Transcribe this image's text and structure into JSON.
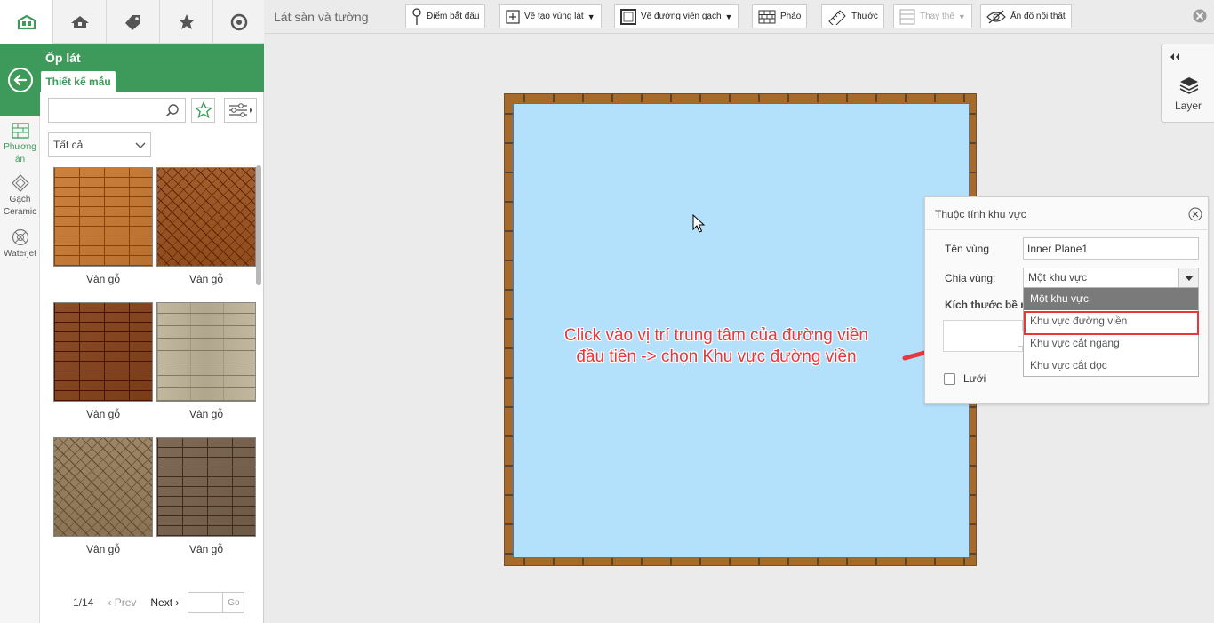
{
  "left_panel": {
    "title": "Ốp lát",
    "tab_label": "Thiết kế mẫu",
    "search": {
      "value": "",
      "placeholder": ""
    },
    "category": {
      "selected": "Tất cả"
    },
    "side_nav": [
      {
        "label": "Phương án",
        "icon": "plan-grid-icon",
        "active": true
      },
      {
        "label": "Gạch Ceramic",
        "icon": "ceramic-tile-icon",
        "active": false
      },
      {
        "label": "Waterjet",
        "icon": "waterjet-icon",
        "active": false
      }
    ],
    "thumbnails": [
      {
        "label": "Vân gỗ",
        "color": "#b9702f",
        "pattern": "bricks"
      },
      {
        "label": "Vân gỗ",
        "color": "#8f4c1d",
        "pattern": "herringbone"
      },
      {
        "label": "Vân gỗ",
        "color": "#7a3c17",
        "pattern": "bricks"
      },
      {
        "label": "Vân gỗ",
        "color": "#b0a68e",
        "pattern": "planks"
      },
      {
        "label": "Vân gỗ",
        "color": "#8a7455",
        "pattern": "herringbone"
      },
      {
        "label": "Vân gỗ",
        "color": "#6d5846",
        "pattern": "bricks"
      }
    ],
    "pager": {
      "info": "1/14",
      "prev": "Prev",
      "next": "Next",
      "go": "Go",
      "page_input": ""
    }
  },
  "toolbar": {
    "title": "Lát sàn và tường",
    "buttons": [
      {
        "label": "Điểm bắt đầu",
        "icon": "pin-icon"
      },
      {
        "label": "Vẽ tạo vùng lát",
        "icon": "add-area-icon"
      },
      {
        "label": "Vẽ đường viền gạch",
        "icon": "border-icon"
      },
      {
        "label": "Phảo",
        "icon": "brick-icon"
      },
      {
        "label": "Thước",
        "icon": "ruler-icon"
      },
      {
        "label": "Thay thế",
        "icon": "replace-icon"
      },
      {
        "label": "Ẩn đồ nội thất",
        "icon": "hide-furniture-icon"
      }
    ]
  },
  "layer_panel": {
    "label": "Layer"
  },
  "annotation": {
    "line1": "Click vào vị trí trung tâm của đường viền",
    "line2": "đầu tiên -> chọn Khu vực đường viền",
    "color": "#e8363c"
  },
  "properties": {
    "title": "Thuộc tính khu vực",
    "name_label": "Tên vùng",
    "name_value": "Inner Plane1",
    "zone_label": "Chia vùng:",
    "zone_selected": "Một khu vực",
    "size_label": "Kích thước bề m",
    "grid_label": "Lưới",
    "zone_options": [
      "Một khu vực",
      "Khu vực đường viền",
      "Khu vực cắt ngang",
      "Khu vực cắt dọc"
    ]
  },
  "colors": {
    "brand_green": "#3e9a5a",
    "floor_blue": "#b3e0fb",
    "wood_border": "#a66b2c"
  }
}
